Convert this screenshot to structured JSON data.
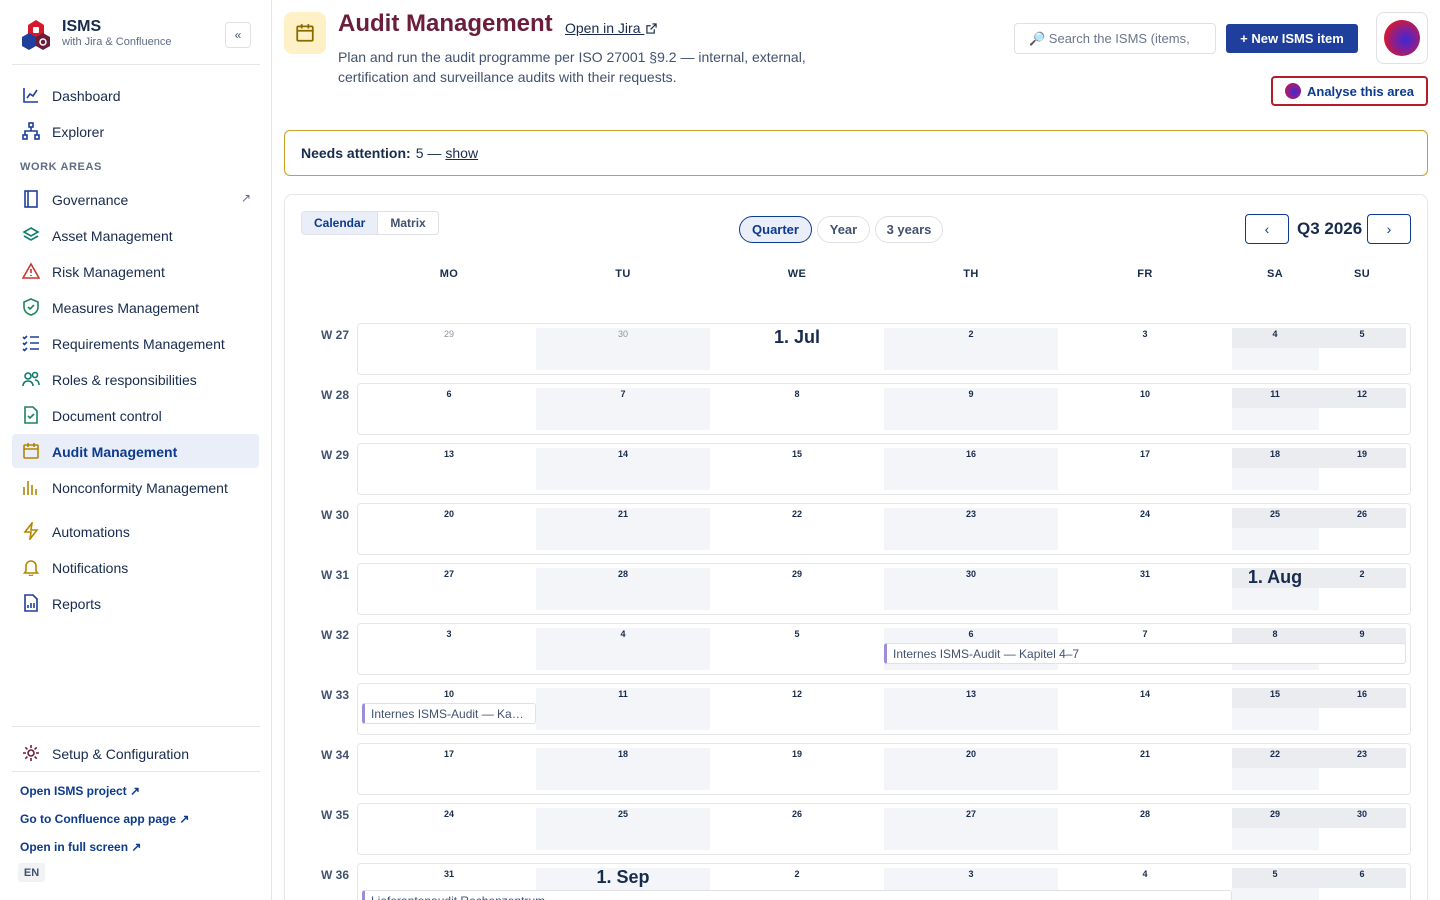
{
  "brand": {
    "title": "ISMS",
    "subtitle": "with Jira & Confluence",
    "collapse": "«"
  },
  "sidebar": {
    "top_items": [
      {
        "label": "Dashboard",
        "icon": "chart-line-icon"
      },
      {
        "label": "Explorer",
        "icon": "hierarchy-icon"
      }
    ],
    "section_label": "WORK AREAS",
    "work_areas": [
      {
        "label": "Governance",
        "icon": "book-icon",
        "external": "↗"
      },
      {
        "label": "Asset Management",
        "icon": "layers-icon"
      },
      {
        "label": "Risk Management",
        "icon": "warning-triangle-icon"
      },
      {
        "label": "Measures Management",
        "icon": "shield-check-icon"
      },
      {
        "label": "Requirements Management",
        "icon": "checklist-icon"
      },
      {
        "label": "Roles & responsibilities",
        "icon": "people-icon"
      },
      {
        "label": "Document control",
        "icon": "document-check-icon"
      },
      {
        "label": "Audit Management",
        "icon": "calendar-icon",
        "active": true
      },
      {
        "label": "Nonconformity Management",
        "icon": "bar-chart-icon"
      }
    ],
    "tools": [
      {
        "label": "Automations",
        "icon": "lightning-icon"
      },
      {
        "label": "Notifications",
        "icon": "bell-icon"
      },
      {
        "label": "Reports",
        "icon": "report-icon"
      }
    ],
    "setup": {
      "label": "Setup & Configuration",
      "icon": "gear-icon"
    },
    "footer_links": [
      "Open ISMS project ↗",
      "Go to Confluence app page ↗",
      "Open in full screen ↗"
    ],
    "language": "EN"
  },
  "header": {
    "title": "Audit Management",
    "jira_link": "Open in Jira",
    "description": "Plan and run the audit programme per ISO 27001 §9.2 — internal, external, certification and surveillance audits with their requests.",
    "search_placeholder": "🔎 Search the ISMS (items,",
    "new_button": "+ New ISMS item",
    "analyse_button": "Analyse this area"
  },
  "attention": {
    "label": "Needs attention:",
    "text": "5 —",
    "link": "show"
  },
  "calendar": {
    "view_tabs": [
      "Calendar",
      "Matrix"
    ],
    "range_pills": [
      "Quarter",
      "Year",
      "3 years"
    ],
    "period": "Q3 2026",
    "prev": "‹",
    "next": "›",
    "weekdays": [
      "MO",
      "TU",
      "WE",
      "TH",
      "FR",
      "SA",
      "SU"
    ],
    "weeks": [
      {
        "label": "W 27",
        "days": [
          "29",
          "30",
          "1. Jul",
          "2",
          "3",
          "4",
          "5"
        ]
      },
      {
        "label": "W 28",
        "days": [
          "6",
          "7",
          "8",
          "9",
          "10",
          "11",
          "12"
        ]
      },
      {
        "label": "W 29",
        "days": [
          "13",
          "14",
          "15",
          "16",
          "17",
          "18",
          "19"
        ]
      },
      {
        "label": "W 30",
        "days": [
          "20",
          "21",
          "22",
          "23",
          "24",
          "25",
          "26"
        ]
      },
      {
        "label": "W 31",
        "days": [
          "27",
          "28",
          "29",
          "30",
          "31",
          "1. Aug",
          "2"
        ]
      },
      {
        "label": "W 32",
        "days": [
          "3",
          "4",
          "5",
          "6",
          "7",
          "8",
          "9"
        ]
      },
      {
        "label": "W 33",
        "days": [
          "10",
          "11",
          "12",
          "13",
          "14",
          "15",
          "16"
        ]
      },
      {
        "label": "W 34",
        "days": [
          "17",
          "18",
          "19",
          "20",
          "21",
          "22",
          "23"
        ]
      },
      {
        "label": "W 35",
        "days": [
          "24",
          "25",
          "26",
          "27",
          "28",
          "29",
          "30"
        ]
      },
      {
        "label": "W 36",
        "days": [
          "31",
          "1. Sep",
          "2",
          "3",
          "4",
          "5",
          "6"
        ]
      }
    ],
    "events": [
      {
        "title": "Internes ISMS-Audit — Kapitel 4–7"
      },
      {
        "title": "Internes ISMS-Audit — Ka…"
      },
      {
        "title": "Lieferantenaudit Rechenzentrum"
      }
    ]
  }
}
